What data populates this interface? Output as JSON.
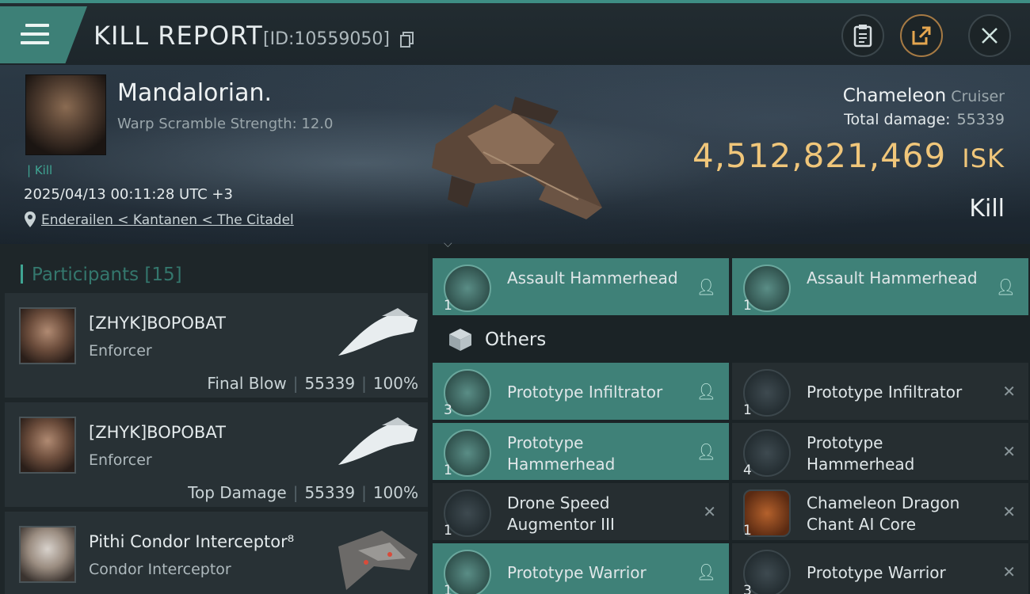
{
  "header": {
    "title": "KILL REPORT",
    "id_text": "[ID:10559050]",
    "icons": [
      "menu-icon",
      "copy-icon",
      "clipboard-icon",
      "share-icon",
      "close-icon"
    ]
  },
  "victim": {
    "name": "Mandalorian.",
    "warp_scramble": "Warp Scramble Strength: 12.0",
    "tag": "| Kill",
    "date": "2025/04/13 00:11:28 UTC +3",
    "location": "Enderailen < Kantanen < The Citadel",
    "ship_name": "Chameleon",
    "ship_class": "Cruiser",
    "total_damage_label": "Total damage:",
    "total_damage_value": "55339",
    "isk_value": "4,512,821,469",
    "isk_unit": "ISK",
    "kill_type": "Kill"
  },
  "participants": {
    "label": "Participants [15]",
    "items": [
      {
        "name": "[ZHYK]BOPOBAT",
        "ship": "Enforcer",
        "role": "Final Blow",
        "damage": "55339",
        "percent": "100%"
      },
      {
        "name": "[ZHYK]BOPOBAT",
        "ship": "Enforcer",
        "role": "Top Damage",
        "damage": "55339",
        "percent": "100%"
      },
      {
        "name": "Pithi Condor Interceptor⁸",
        "ship": "Condor Interceptor",
        "role": "",
        "damage": "",
        "percent": ""
      }
    ]
  },
  "items": {
    "top_row": [
      {
        "name": "Assault Hammerhead",
        "qty": "1",
        "status": "dropped"
      },
      {
        "name": "Assault Hammerhead",
        "qty": "1",
        "status": "dropped"
      }
    ],
    "others_label": "Others",
    "others": [
      {
        "name": "Prototype  Infiltrator",
        "qty": "3",
        "status": "dropped"
      },
      {
        "name": "Prototype  Infiltrator",
        "qty": "1",
        "status": "destroyed"
      },
      {
        "name": "Prototype Hammerhead",
        "qty": "1",
        "status": "dropped"
      },
      {
        "name": "Prototype Hammerhead",
        "qty": "4",
        "status": "destroyed"
      },
      {
        "name": "Drone Speed Augmentor III",
        "qty": "1",
        "status": "destroyed"
      },
      {
        "name": "Chameleon Dragon Chant AI Core",
        "qty": "1",
        "status": "destroyed"
      },
      {
        "name": "Prototype  Warrior",
        "qty": "1",
        "status": "dropped"
      },
      {
        "name": "Prototype  Warrior",
        "qty": "3",
        "status": "destroyed"
      }
    ]
  },
  "colors": {
    "accent": "#3fa593",
    "dropped_bg": "#3f8178",
    "isk": "#f0c67a"
  }
}
